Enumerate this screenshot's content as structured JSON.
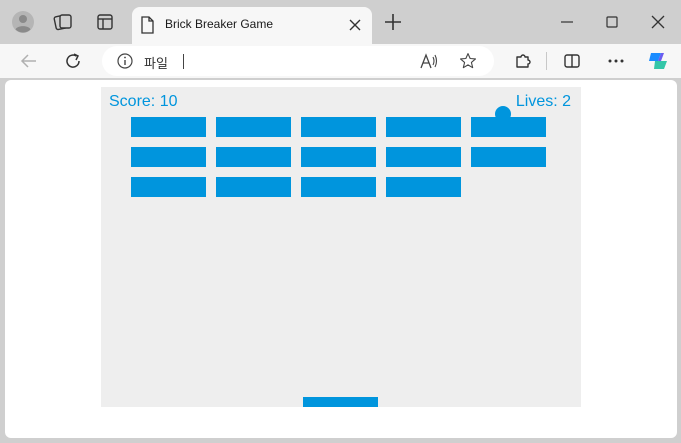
{
  "browser": {
    "tab_title": "Brick Breaker Game",
    "address": "파일",
    "icons": [
      "profile-icon",
      "workspaces-icon",
      "tab-actions-icon",
      "document-icon",
      "close-icon",
      "new-tab-icon",
      "minimize-icon",
      "maximize-icon",
      "window-close-icon",
      "back-icon",
      "refresh-icon",
      "info-icon",
      "read-aloud-icon",
      "favorite-icon",
      "extensions-icon",
      "split-screen-icon",
      "more-icon",
      "copilot-icon"
    ]
  },
  "game": {
    "score_text": "Score: 10",
    "lives_text": "Lives: 2",
    "score": 10,
    "lives": 2,
    "brick_grid": [
      [
        true,
        true,
        true,
        true,
        true
      ],
      [
        true,
        true,
        true,
        true,
        true
      ],
      [
        true,
        true,
        true,
        true,
        false
      ]
    ],
    "colors": {
      "accent": "#0095DD",
      "background": "#eeeeee"
    }
  }
}
